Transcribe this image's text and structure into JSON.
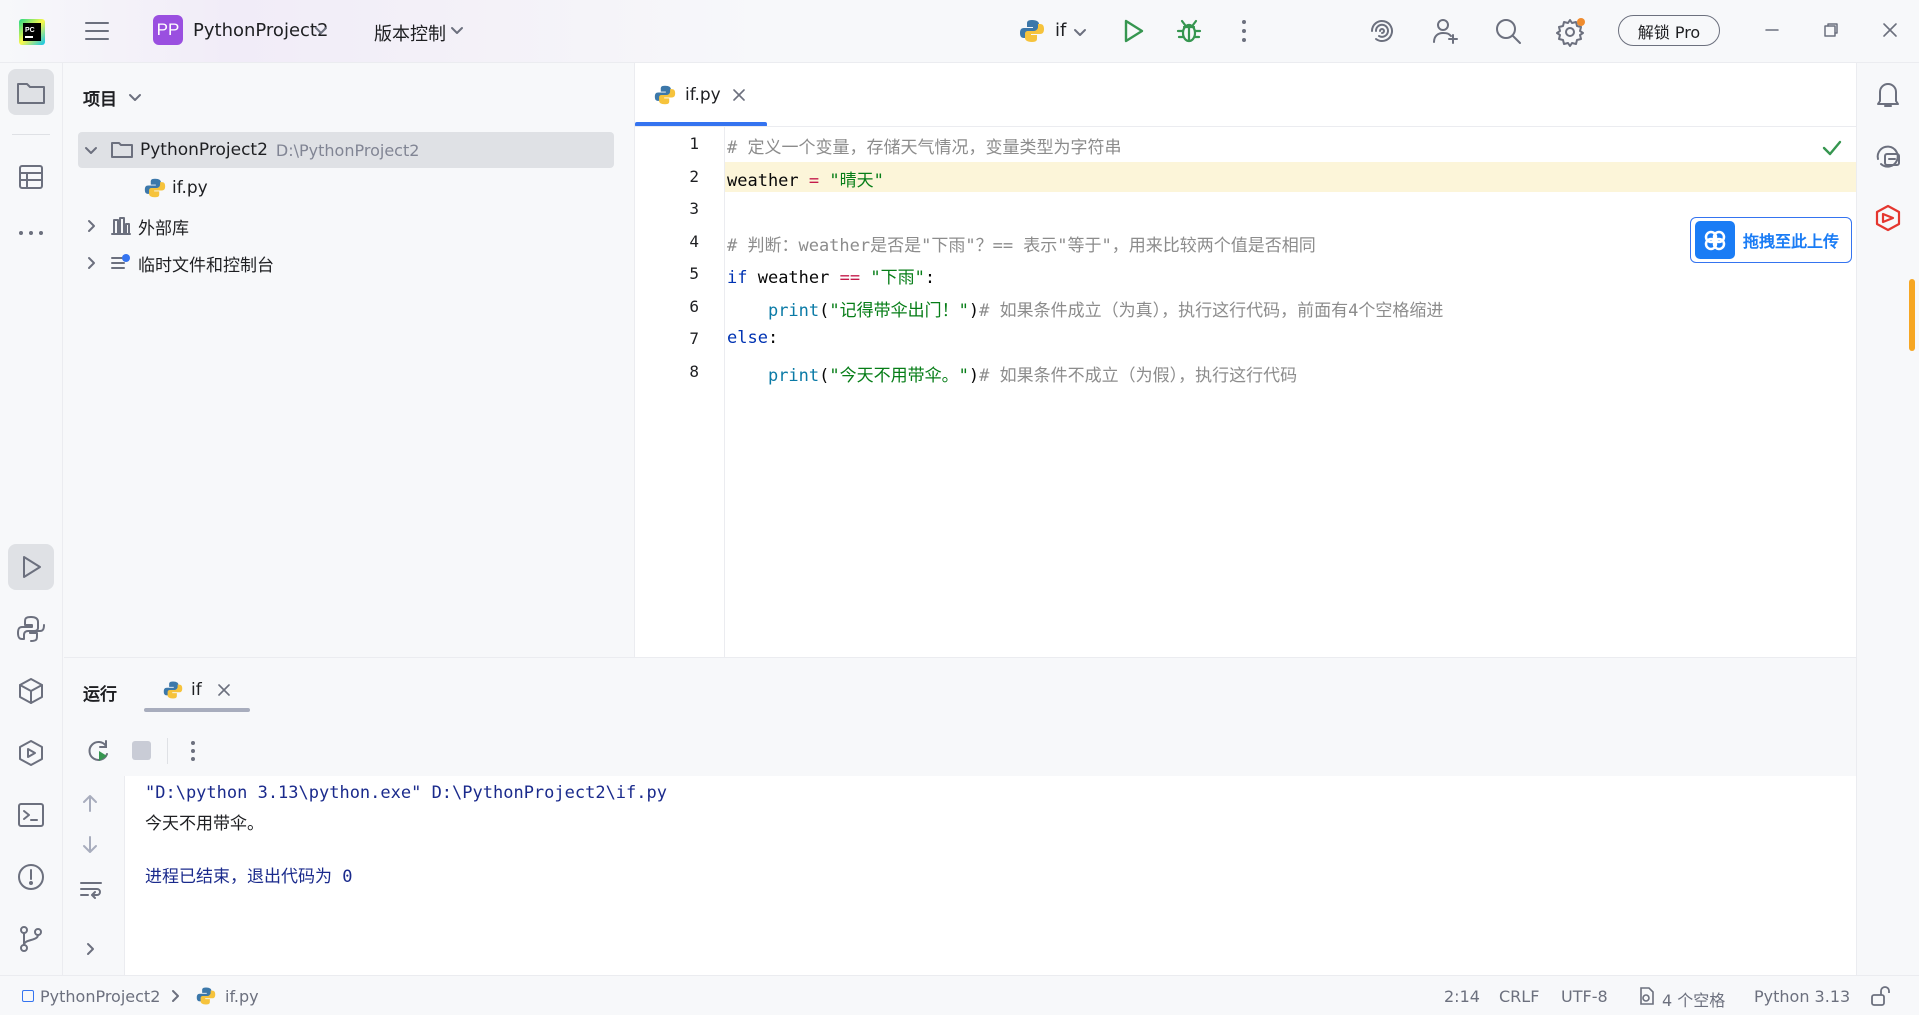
{
  "titlebar": {
    "project_badge": "PP",
    "project_name": "PythonProject2",
    "vcs_label": "版本控制",
    "run_config": "if",
    "unlock_label": "解锁 Pro"
  },
  "project_panel": {
    "title": "项目",
    "root_name": "PythonProject2",
    "root_path": "D:\\PythonProject2",
    "file_name": "if.py",
    "external_libs": "外部库",
    "scratches": "临时文件和控制台"
  },
  "editor": {
    "tab_name": "if.py",
    "upload_label": "拖拽至此上传",
    "line_numbers": [
      "1",
      "2",
      "3",
      "4",
      "5",
      "6",
      "7",
      "8"
    ]
  },
  "code": {
    "l1": "# 定义一个变量，存储天气情况，变量类型为字符串",
    "l2_a": "weather",
    "l2_b": " = ",
    "l2_c": "\"晴天\"",
    "l4_a": "# 判断：weather是否是\"下雨\"？== 表示\"等于\"，用来比较两个值是否相同",
    "l5_a": "if",
    "l5_b": " weather ",
    "l5_c": "==",
    "l5_d": " ",
    "l5_e": "\"下雨\"",
    "l5_f": ":",
    "l6_a": "    ",
    "l6_b": "print",
    "l6_c": "(",
    "l6_d": "\"记得带伞出门！\"",
    "l6_e": ")",
    "l6_f": "# 如果条件成立（为真），执行这行代码，前面有4个空格缩进",
    "l7_a": "else",
    "l7_b": ":",
    "l8_a": "    ",
    "l8_b": "print",
    "l8_c": "(",
    "l8_d": "\"今天不用带伞。\"",
    "l8_e": ")",
    "l8_f": "# 如果条件不成立（为假），执行这行代码"
  },
  "run_panel": {
    "title": "运行",
    "tab_name": "if",
    "console": {
      "cmd": "\"D:\\python 3.13\\python.exe\" D:\\PythonProject2\\if.py",
      "output": "今天不用带伞。",
      "exit": "进程已结束，退出代码为 0"
    }
  },
  "statusbar": {
    "crumb_project": "PythonProject2",
    "crumb_file": "if.py",
    "position": "2:14",
    "line_sep": "CRLF",
    "encoding": "UTF-8",
    "indent": "4 个空格",
    "interpreter": "Python 3.13"
  },
  "colors": {
    "accent": "#3574f0",
    "current_line": "#fcf5d9",
    "badge": "#9a4fe0",
    "run_green": "#369650"
  }
}
